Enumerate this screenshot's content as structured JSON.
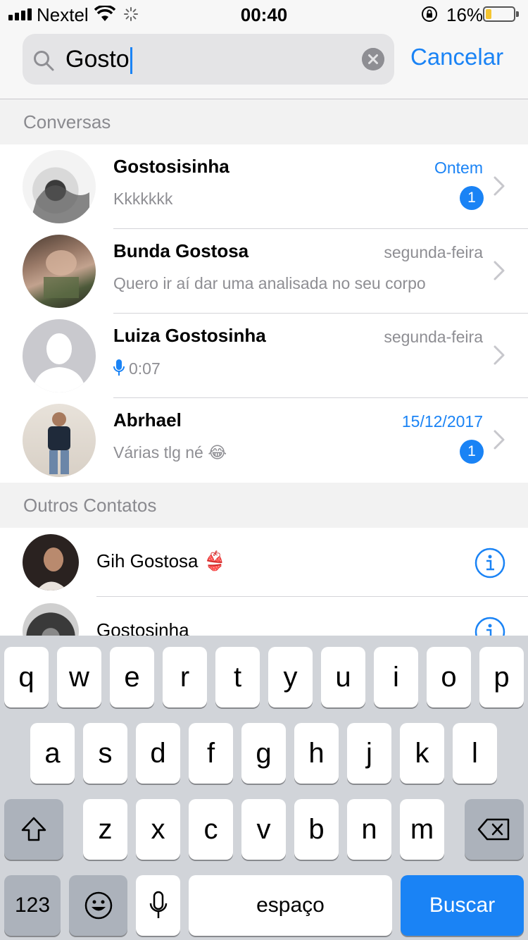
{
  "status_bar": {
    "carrier": "Nextel",
    "time": "00:40",
    "battery_percent": "16%",
    "battery_level": 0.16,
    "icons": [
      "signal-icon",
      "wifi-icon",
      "activity-spinner-icon",
      "orientation-lock-icon",
      "battery-icon"
    ]
  },
  "search": {
    "query": "Gosto",
    "cancel_label": "Cancelar"
  },
  "sections": {
    "chats_header": "Conversas",
    "contacts_header": "Outros Contatos"
  },
  "chats": [
    {
      "name": "Gostosisinha",
      "time": "Ontem",
      "preview": "Kkkkkkk",
      "unread": "1"
    },
    {
      "name": "Bunda Gostosa",
      "time": "segunda-feira",
      "preview": "Quero ir aí dar uma analisada no seu corpo",
      "unread": ""
    },
    {
      "name": "Luiza Gostosinha",
      "time": "segunda-feira",
      "preview": "0:07",
      "unread": ""
    },
    {
      "name": "Abrhael",
      "time": "15/12/2017",
      "preview": "Várias tlg né 😂",
      "unread": "1"
    }
  ],
  "contacts": [
    {
      "name": "Gih Gostosa 👙"
    },
    {
      "name": "Gostosinha"
    }
  ],
  "keyboard": {
    "row1": [
      "q",
      "w",
      "e",
      "r",
      "t",
      "y",
      "u",
      "i",
      "o",
      "p"
    ],
    "row2": [
      "a",
      "s",
      "d",
      "f",
      "g",
      "h",
      "j",
      "k",
      "l"
    ],
    "row3": [
      "z",
      "x",
      "c",
      "v",
      "b",
      "n",
      "m"
    ],
    "numbers_label": "123",
    "space_label": "espaço",
    "action_label": "Buscar"
  },
  "colors": {
    "accent": "#1a83f5",
    "secondary_text": "#8e8e93",
    "battery_fill": "#f4c531"
  }
}
